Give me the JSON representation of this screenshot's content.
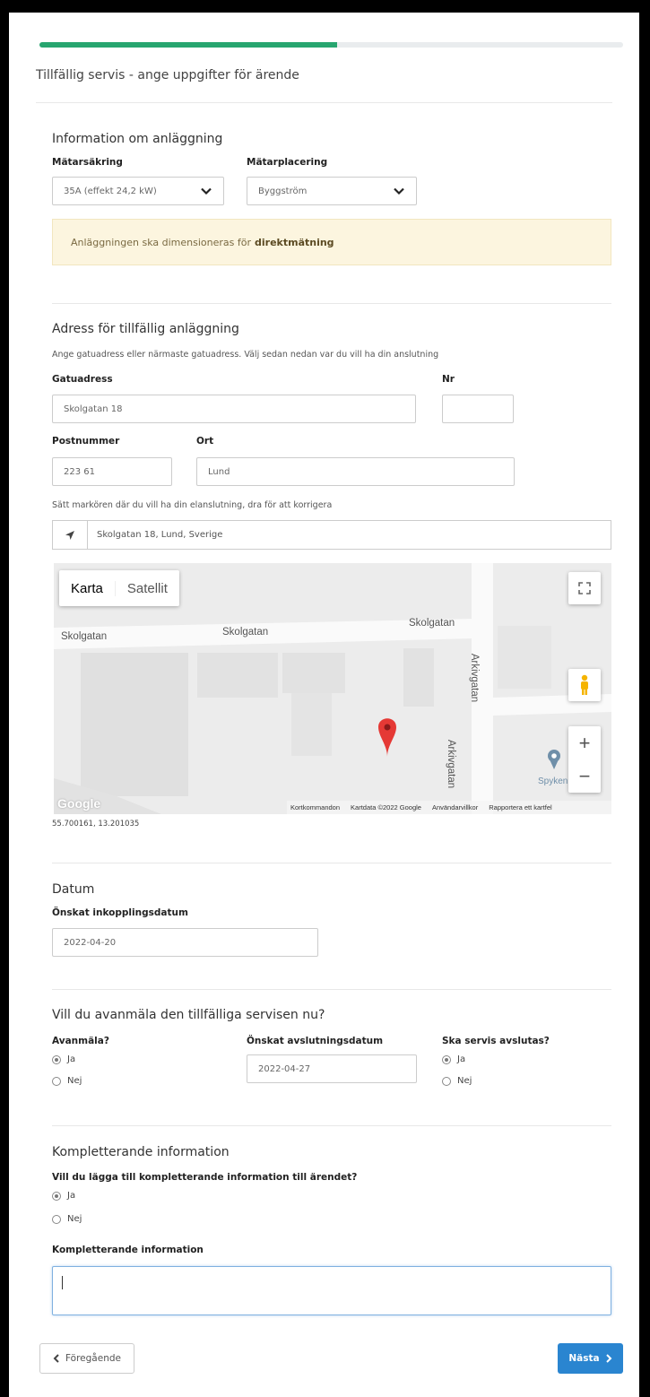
{
  "progress": {
    "fraction": 0.51
  },
  "page_title": "Tillfällig servis - ange uppgifter för ärende",
  "facility": {
    "title": "Information om anläggning",
    "fuse_label": "Mätarsäkring",
    "fuse_value": "35A (effekt 24,2 kW)",
    "placement_label": "Mätarplacering",
    "placement_value": "Byggström",
    "alert_text": "Anläggningen ska dimensioneras för",
    "alert_bold": "direktmätning"
  },
  "address": {
    "title": "Adress för tillfällig anläggning",
    "hint": "Ange gatuadress eller närmaste gatuadress. Välj sedan nedan var du vill ha din anslutning",
    "street_label": "Gatuadress",
    "street_value": "Skolgatan 18",
    "nr_label": "Nr",
    "nr_value": "",
    "postcode_label": "Postnummer",
    "postcode_value": "223 61",
    "city_label": "Ort",
    "city_value": "Lund",
    "marker_hint": "Sätt markören där du vill ha din elanslutning, dra för att korrigera",
    "geo_value": "Skolgatan 18, Lund, Sverige"
  },
  "map": {
    "type_map": "Karta",
    "type_satellite": "Satellit",
    "streets": [
      "Skolgatan",
      "Skolgatan",
      "Skolgatan",
      "Arkivgatan",
      "Arkivgatan"
    ],
    "poi": "Spyken",
    "logo": "Google",
    "footer": [
      "Kortkommandon",
      "Kartdata ©2022 Google",
      "Användarvillkor",
      "Rapportera ett kartfel"
    ],
    "zoom_in": "+",
    "zoom_out": "−",
    "coords": "55.700161, 13.201035"
  },
  "date": {
    "title": "Datum",
    "label": "Önskat inkopplingsdatum",
    "value": "2022-04-20"
  },
  "deregister": {
    "title": "Vill du avanmäla den tillfälliga servisen nu?",
    "q1_label": "Avanmäla?",
    "q1_yes": "Ja",
    "q1_no": "Nej",
    "end_date_label": "Önskat avslutningsdatum",
    "end_date_value": "2022-04-27",
    "q2_label": "Ska servis avslutas?",
    "q2_yes": "Ja",
    "q2_no": "Nej"
  },
  "extra": {
    "title": "Kompletterande information",
    "question": "Vill du lägga till kompletterande information till ärendet?",
    "yes": "Ja",
    "no": "Nej",
    "field_label": "Kompletterande information",
    "field_value": ""
  },
  "nav": {
    "prev_label": "Föregående",
    "next_label": "Nästa"
  }
}
